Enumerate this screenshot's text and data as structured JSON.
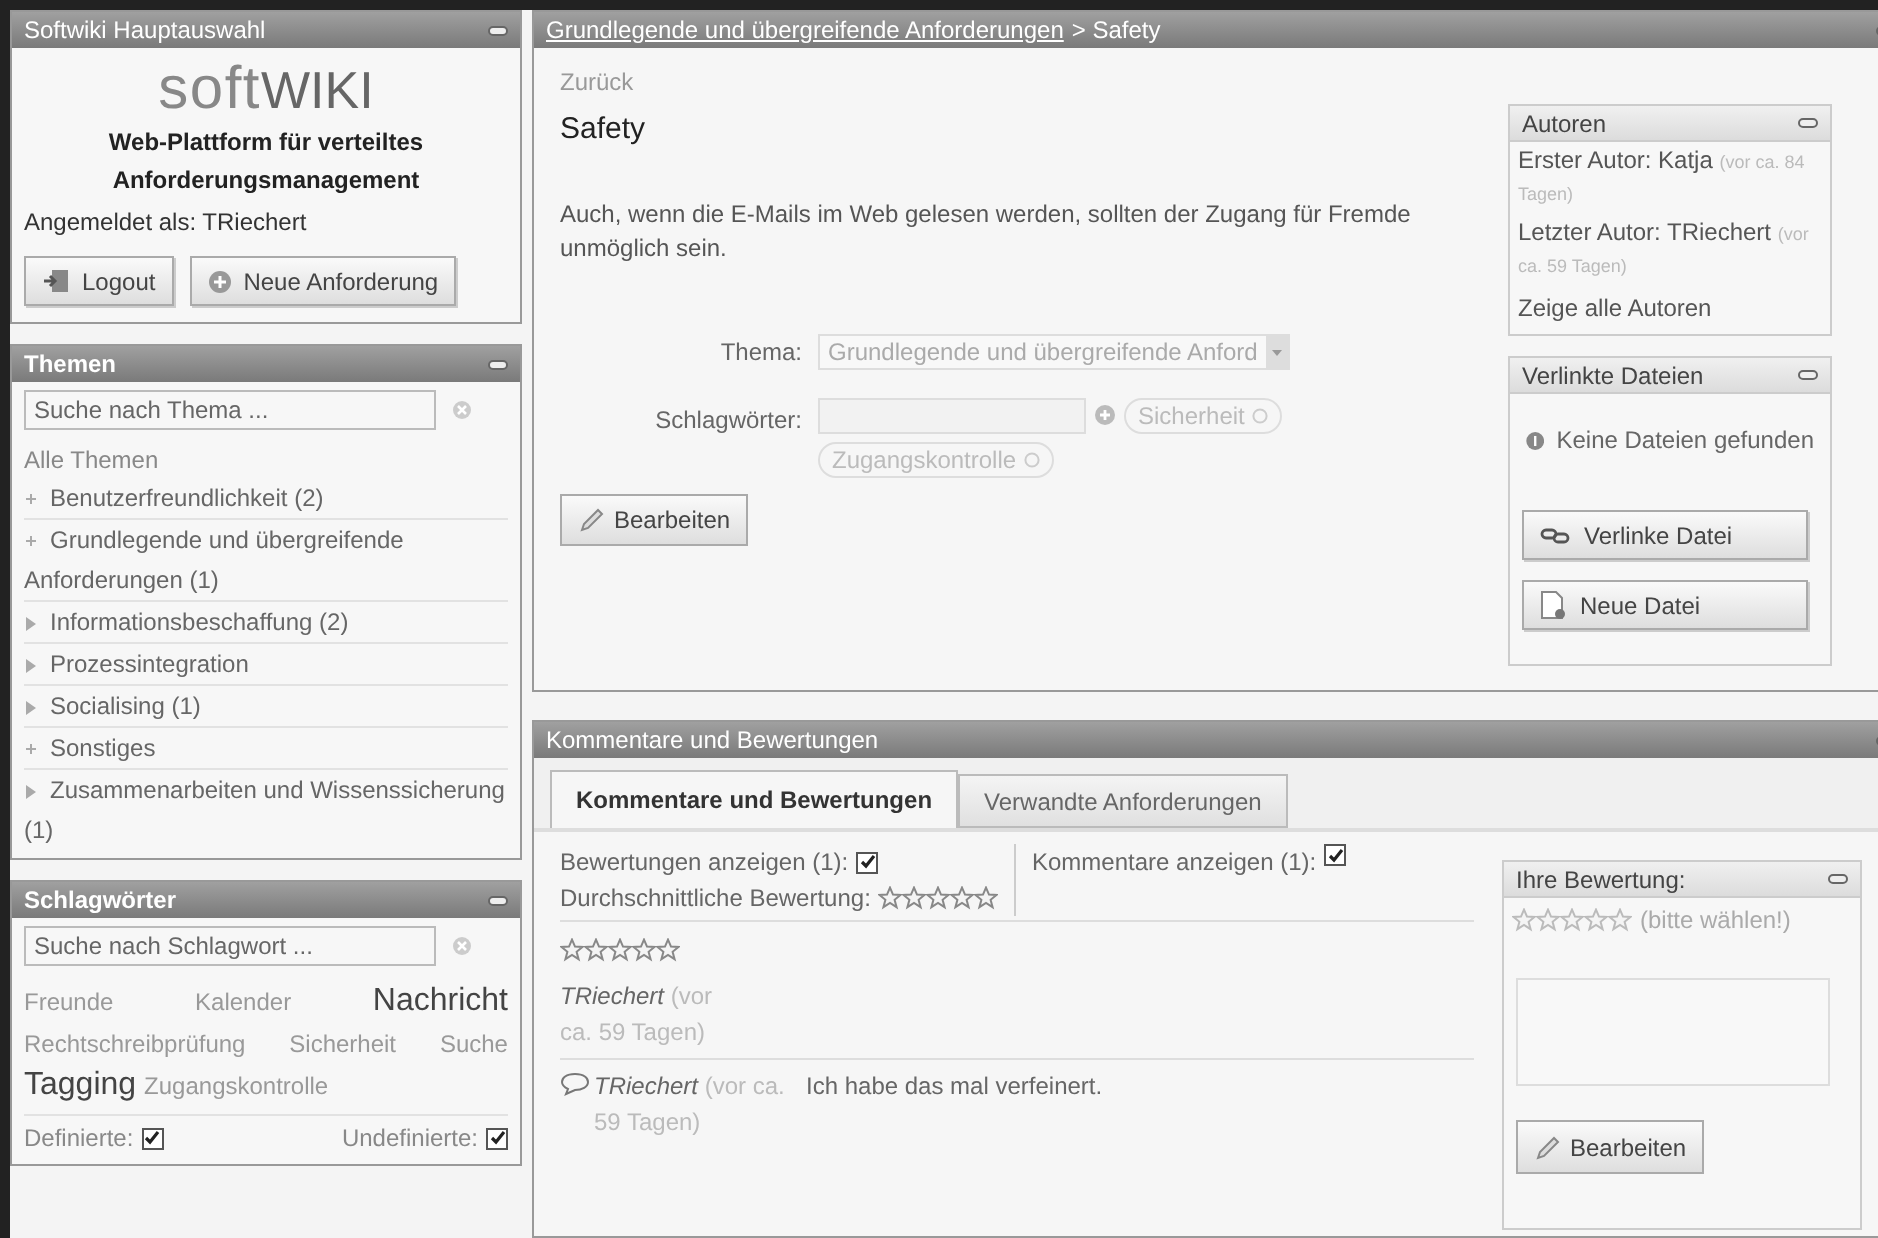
{
  "sidebar": {
    "main_panel": {
      "title": "Softwiki Hauptauswahl",
      "logo_light": "soft",
      "logo_bold": "WIKI",
      "tagline": "Web-Plattform für verteiltes Anforderungsmanagement",
      "login": "Angemeldet als: TRiechert",
      "buttons": [
        {
          "label": "Logout",
          "kind": "logout"
        },
        {
          "label": "Neue Anforderung",
          "kind": "add"
        }
      ]
    },
    "topics_panel": {
      "title": "Themen",
      "search": {
        "placeholder": "Suche nach Thema ..."
      },
      "all": "Alle Themen",
      "items": [
        {
          "label": "Benutzerfreundlichkeit (2)",
          "kind": "leaf"
        },
        {
          "label": "Grundlegende und übergreifende Anforderungen (1)",
          "kind": "leaf"
        },
        {
          "label": "Informationsbeschaffung (2)",
          "kind": "collapsed"
        },
        {
          "label": "Prozessintegration",
          "kind": "collapsed"
        },
        {
          "label": "Socialising (1)",
          "kind": "collapsed"
        },
        {
          "label": "Sonstiges",
          "kind": "leaf"
        },
        {
          "label": "Zusammenarbeiten und Wissenssicherung (1)",
          "kind": "collapsed"
        }
      ]
    },
    "tags_panel": {
      "title": "Schlagwörter",
      "search": {
        "placeholder": "Suche nach Schlagwort ..."
      },
      "tag_rows": [
        [
          {
            "label": "Freunde",
            "kind": "small"
          },
          {
            "label": "Kalender",
            "kind": "small"
          },
          {
            "label": "Nachricht",
            "kind": "large"
          }
        ],
        [
          {
            "label": "Rechtschreibprüfung",
            "kind": "small"
          },
          {
            "label": "Sicherheit",
            "kind": "small"
          },
          {
            "label": "Suche",
            "kind": "small"
          }
        ],
        [
          {
            "label": "Tagging",
            "kind": "large"
          },
          {
            "label": "Zugangskontrolle",
            "kind": "small"
          }
        ]
      ],
      "filters": [
        {
          "label": "Definierte:",
          "checked": true
        },
        {
          "label": "Undefinierte:",
          "checked": true
        }
      ]
    }
  },
  "requirement": {
    "breadcrumb_link": "Grundlegende und übergreifende Anforderungen",
    "breadcrumb_rest": "> Safety",
    "back": "Zurück",
    "title": "Safety",
    "description": "Auch, wenn die E-Mails im Web gelesen werden, sollten der Zugang für Fremde unmöglich sein.",
    "topic_label": "Thema:",
    "topic_value": "Grundlegende und übergreifende Anford",
    "tags_label": "Schlagwörter:",
    "tags": [
      "Sicherheit",
      "Zugangskontrolle"
    ],
    "edit_button": "Bearbeiten",
    "authors": {
      "title": "Autoren",
      "entries": [
        {
          "label": "Erster Autor: Katja",
          "time": "(vor ca. 84 Tagen)"
        },
        {
          "label": "Letzter Autor: TRiechert",
          "time": "(vor ca. 59 Tagen)"
        }
      ],
      "show_all": "Zeige alle Autoren"
    },
    "files": {
      "title": "Verlinkte Dateien",
      "empty": "Keine Dateien gefunden",
      "buttons": [
        {
          "label": "Verlinke Datei",
          "kind": "link"
        },
        {
          "label": "Neue Datei",
          "kind": "file"
        }
      ]
    }
  },
  "comments": {
    "title": "Kommentare und Bewertungen",
    "tabs": [
      {
        "label": "Kommentare und Bewertungen",
        "selected": true
      },
      {
        "label": "Verwandte Anforderungen",
        "selected": false
      }
    ],
    "show_ratings": {
      "label": "Bewertungen anzeigen (1):",
      "checked": true
    },
    "average": {
      "label": "Durchschnittliche Bewertung:",
      "stars": 0
    },
    "show_comments": {
      "label": "Kommentare anzeigen (1):",
      "checked": true
    },
    "ratings": [
      {
        "stars": 0,
        "author": "TRiechert",
        "time": "(vor ca. 59 Tagen)"
      }
    ],
    "entries": [
      {
        "author": "TRiechert",
        "time": "(vor ca. 59 Tagen)",
        "text": "Ich habe das mal verfeinert."
      }
    ],
    "your_rating": {
      "title": "Ihre Bewertung:",
      "stars": 0,
      "hint": "(bitte wählen!)",
      "edit_button": "Bearbeiten"
    }
  }
}
